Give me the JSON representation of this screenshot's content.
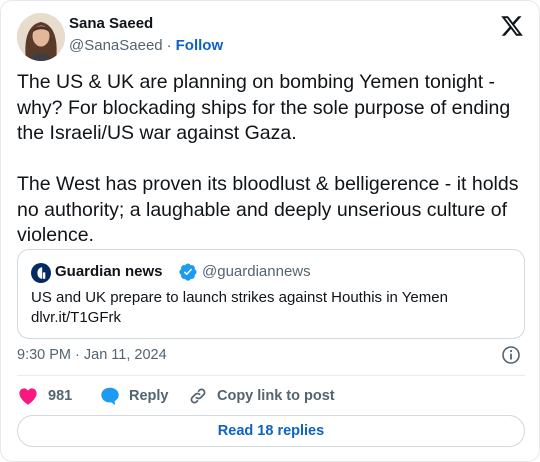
{
  "author": {
    "name": "Sana Saeed",
    "handle": "@SanaSaeed",
    "separator": "·",
    "follow_label": "Follow"
  },
  "tweet": {
    "text": "The US & UK are planning on bombing Yemen tonight - why? For blockading ships for the sole purpose of ending the Israeli/US war against Gaza.\n\nThe West has proven its bloodlust & belligerence - it holds no authority; a laughable and deeply unserious culture of violence."
  },
  "quote": {
    "name": "Guardian news",
    "handle": "@guardiannews",
    "text": "US and UK prepare to launch strikes against Houthis in Yemen",
    "link": "dlvr.it/T1GFrk"
  },
  "timestamp": "9:30 PM · Jan 11, 2024",
  "actions": {
    "likes": "981",
    "reply_label": "Reply",
    "copy_label": "Copy link to post"
  },
  "read_replies_label": "Read 18 replies",
  "icons": {
    "platform": "x-logo-icon",
    "verified": "verified-badge-icon",
    "info": "info-icon",
    "like": "heart-icon",
    "reply": "reply-bubble-icon",
    "copy": "link-icon"
  },
  "colors": {
    "text": "#0f1419",
    "secondary": "#536471",
    "link": "#0c64c2",
    "like": "#f91880",
    "reply": "#1d9bf0",
    "border": "#cfd9de"
  }
}
